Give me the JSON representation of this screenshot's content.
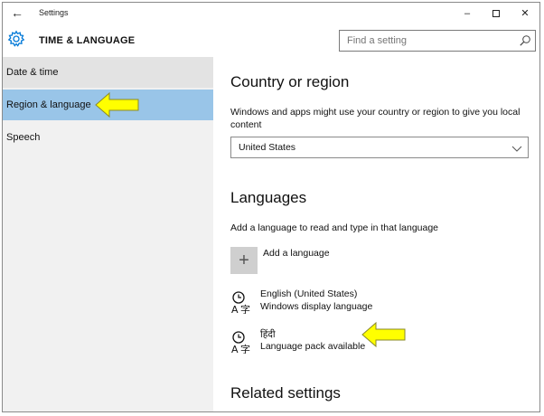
{
  "window": {
    "back_icon": "back-arrow-icon",
    "title": "Settings",
    "minimize": "–",
    "close": "✕"
  },
  "header": {
    "icon": "gear-icon",
    "title": "TIME & LANGUAGE",
    "search_placeholder": "Find a setting"
  },
  "sidebar": {
    "items": [
      {
        "label": "Date & time",
        "selected": false
      },
      {
        "label": "Region & language",
        "selected": true
      },
      {
        "label": "Speech",
        "selected": false
      }
    ]
  },
  "main": {
    "country": {
      "heading": "Country or region",
      "description": "Windows and apps might use your country or region to give you local content",
      "selected": "United States"
    },
    "languages": {
      "heading": "Languages",
      "description": "Add a language to read and type in that language",
      "add_label": "Add a language",
      "items": [
        {
          "name": "English (United States)",
          "status": "Windows display language"
        },
        {
          "name": "हिंदी",
          "status": "Language pack available"
        }
      ]
    },
    "related": {
      "heading": "Related settings"
    }
  },
  "colors": {
    "selected_item": "#99c5e8",
    "sidebar_bg": "#f1f1f1",
    "arrow_fill": "#ffff00",
    "accent": "#0078d7"
  }
}
